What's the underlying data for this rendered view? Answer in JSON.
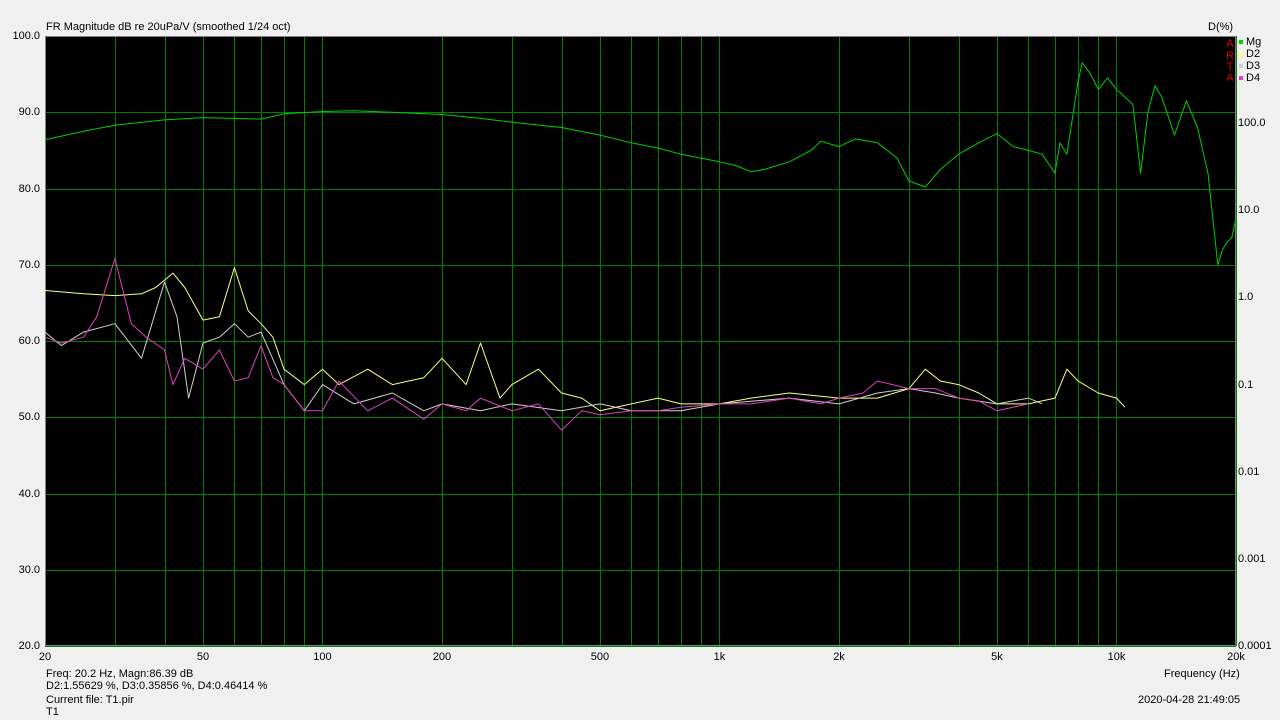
{
  "window": {
    "title": "FR Magnitude dB re 20uPa/V (smoothed 1/24 oct)",
    "right_axis_title": "D(%)"
  },
  "status": {
    "line1": "Freq: 20.2 Hz, Magn:86.39 dB",
    "line2": "D2:1.55629 %, D3:0.35856 %, D4:0.46414 %",
    "line3": "Current file: T1.pir",
    "line4": "T1",
    "timestamp": "2020-04-28  21:49:05"
  },
  "brand_letters": [
    "A",
    "R",
    "T",
    "A"
  ],
  "chart_data": {
    "type": "line",
    "title": "FR Magnitude dB re 20uPa/V (smoothed 1/24 oct)",
    "xlabel": "Frequency (Hz)",
    "x_scale": "log",
    "xlim": [
      20,
      20000
    ],
    "x_ticks": [
      {
        "value": 20,
        "label": "20"
      },
      {
        "value": 50,
        "label": "50"
      },
      {
        "value": 100,
        "label": "100"
      },
      {
        "value": 200,
        "label": "200"
      },
      {
        "value": 500,
        "label": "500"
      },
      {
        "value": 1000,
        "label": "1k"
      },
      {
        "value": 2000,
        "label": "2k"
      },
      {
        "value": 5000,
        "label": "5k"
      },
      {
        "value": 10000,
        "label": "10k"
      },
      {
        "value": 20000,
        "label": "20k"
      }
    ],
    "ylim": [
      20,
      100
    ],
    "y_ticks": [
      "100.0",
      "90.0",
      "80.0",
      "70.0",
      "60.0",
      "50.0",
      "40.0",
      "30.0",
      "20.0"
    ],
    "y2_scale": "log",
    "y2lim": [
      0.0001,
      1000
    ],
    "y2_ticks": [
      "100.0",
      "10.0",
      "1.0",
      "0.1",
      "0.01",
      "0.001",
      "0.0001"
    ],
    "grid": true,
    "legend_position": "top-right",
    "colors": {
      "background": "#000000",
      "grid": "#008000"
    },
    "series": [
      {
        "name": "Mg",
        "axis": "left",
        "color": "#00d000",
        "x": [
          20,
          25,
          30,
          40,
          50,
          60,
          70,
          80,
          100,
          120,
          150,
          200,
          250,
          300,
          400,
          500,
          600,
          700,
          800,
          1000,
          1100,
          1200,
          1300,
          1500,
          1700,
          1800,
          2000,
          2200,
          2500,
          2800,
          3000,
          3300,
          3600,
          4000,
          4500,
          5000,
          5500,
          6000,
          6500,
          7000,
          7200,
          7500,
          8000,
          8200,
          8600,
          9000,
          9500,
          10000,
          10500,
          11000,
          11500,
          12000,
          12500,
          13000,
          14000,
          15000,
          16000,
          17000,
          18000,
          18500,
          19000,
          19500,
          20000
        ],
        "y": [
          86.4,
          87.5,
          88.3,
          89.0,
          89.3,
          89.2,
          89.1,
          89.8,
          90.1,
          90.2,
          90.0,
          89.7,
          89.2,
          88.7,
          88.0,
          87.0,
          86.0,
          85.3,
          84.5,
          83.5,
          83.0,
          82.2,
          82.5,
          83.5,
          85.0,
          86.2,
          85.5,
          86.5,
          86.0,
          84.0,
          81.0,
          80.2,
          82.5,
          84.5,
          86.0,
          87.2,
          85.5,
          85.0,
          84.5,
          82.0,
          86.0,
          84.5,
          94.0,
          96.5,
          95.0,
          93.0,
          94.5,
          93.0,
          92.0,
          91.0,
          82.0,
          90.0,
          93.5,
          92.0,
          87.0,
          91.5,
          88.0,
          82.0,
          70.0,
          72.0,
          73.0,
          73.5,
          76.0
        ]
      },
      {
        "name": "D2",
        "axis": "right",
        "color": "#ffff80",
        "x": [
          20,
          25,
          30,
          35,
          38,
          42,
          45,
          50,
          55,
          60,
          65,
          70,
          75,
          80,
          90,
          100,
          110,
          130,
          150,
          180,
          200,
          230,
          250,
          280,
          300,
          350,
          400,
          450,
          500,
          600,
          700,
          800,
          1000,
          1200,
          1500,
          2000,
          2500,
          3000,
          3300,
          3600,
          4000,
          4500,
          5000,
          6000,
          7000,
          7500,
          8000,
          9000,
          10000,
          10500
        ],
        "y": [
          1.2,
          1.1,
          1.05,
          1.1,
          1.3,
          1.9,
          1.3,
          0.55,
          0.6,
          2.2,
          0.7,
          0.5,
          0.35,
          0.15,
          0.1,
          0.15,
          0.1,
          0.15,
          0.1,
          0.12,
          0.2,
          0.1,
          0.3,
          0.07,
          0.1,
          0.15,
          0.08,
          0.07,
          0.05,
          0.06,
          0.07,
          0.06,
          0.06,
          0.07,
          0.08,
          0.07,
          0.07,
          0.09,
          0.15,
          0.11,
          0.1,
          0.08,
          0.06,
          0.06,
          0.07,
          0.15,
          0.11,
          0.08,
          0.07,
          0.055
        ]
      },
      {
        "name": "D3",
        "axis": "right",
        "color": "#d0d0d0",
        "x": [
          20,
          22,
          25,
          30,
          35,
          40,
          43,
          46,
          50,
          55,
          60,
          65,
          70,
          80,
          90,
          100,
          120,
          150,
          180,
          200,
          250,
          300,
          400,
          500,
          600,
          800,
          1000,
          1500,
          2000,
          2500,
          3000,
          3500,
          4000,
          5000,
          6000,
          6500
        ],
        "y": [
          0.4,
          0.28,
          0.4,
          0.5,
          0.2,
          1.5,
          0.6,
          0.07,
          0.3,
          0.35,
          0.5,
          0.35,
          0.4,
          0.1,
          0.05,
          0.1,
          0.06,
          0.08,
          0.05,
          0.06,
          0.05,
          0.06,
          0.05,
          0.06,
          0.05,
          0.05,
          0.06,
          0.07,
          0.06,
          0.08,
          0.09,
          0.08,
          0.07,
          0.06,
          0.07,
          0.06
        ]
      },
      {
        "name": "D4",
        "axis": "right",
        "color": "#e040c0",
        "x": [
          20,
          22,
          25,
          27,
          30,
          33,
          36,
          40,
          42,
          45,
          50,
          55,
          60,
          65,
          70,
          75,
          80,
          90,
          100,
          110,
          130,
          150,
          180,
          200,
          230,
          250,
          300,
          350,
          400,
          450,
          500,
          600,
          700,
          800,
          1000,
          1200,
          1500,
          1800,
          2000,
          2300,
          2500,
          3000,
          3500,
          4000,
          4500,
          5000,
          6000
        ],
        "y": [
          0.35,
          0.3,
          0.35,
          0.6,
          2.8,
          0.5,
          0.35,
          0.25,
          0.1,
          0.2,
          0.15,
          0.25,
          0.11,
          0.12,
          0.28,
          0.12,
          0.1,
          0.05,
          0.05,
          0.11,
          0.05,
          0.07,
          0.04,
          0.06,
          0.05,
          0.07,
          0.05,
          0.06,
          0.03,
          0.05,
          0.045,
          0.05,
          0.05,
          0.055,
          0.06,
          0.06,
          0.07,
          0.06,
          0.07,
          0.08,
          0.11,
          0.09,
          0.09,
          0.07,
          0.065,
          0.05,
          0.06
        ]
      }
    ]
  }
}
